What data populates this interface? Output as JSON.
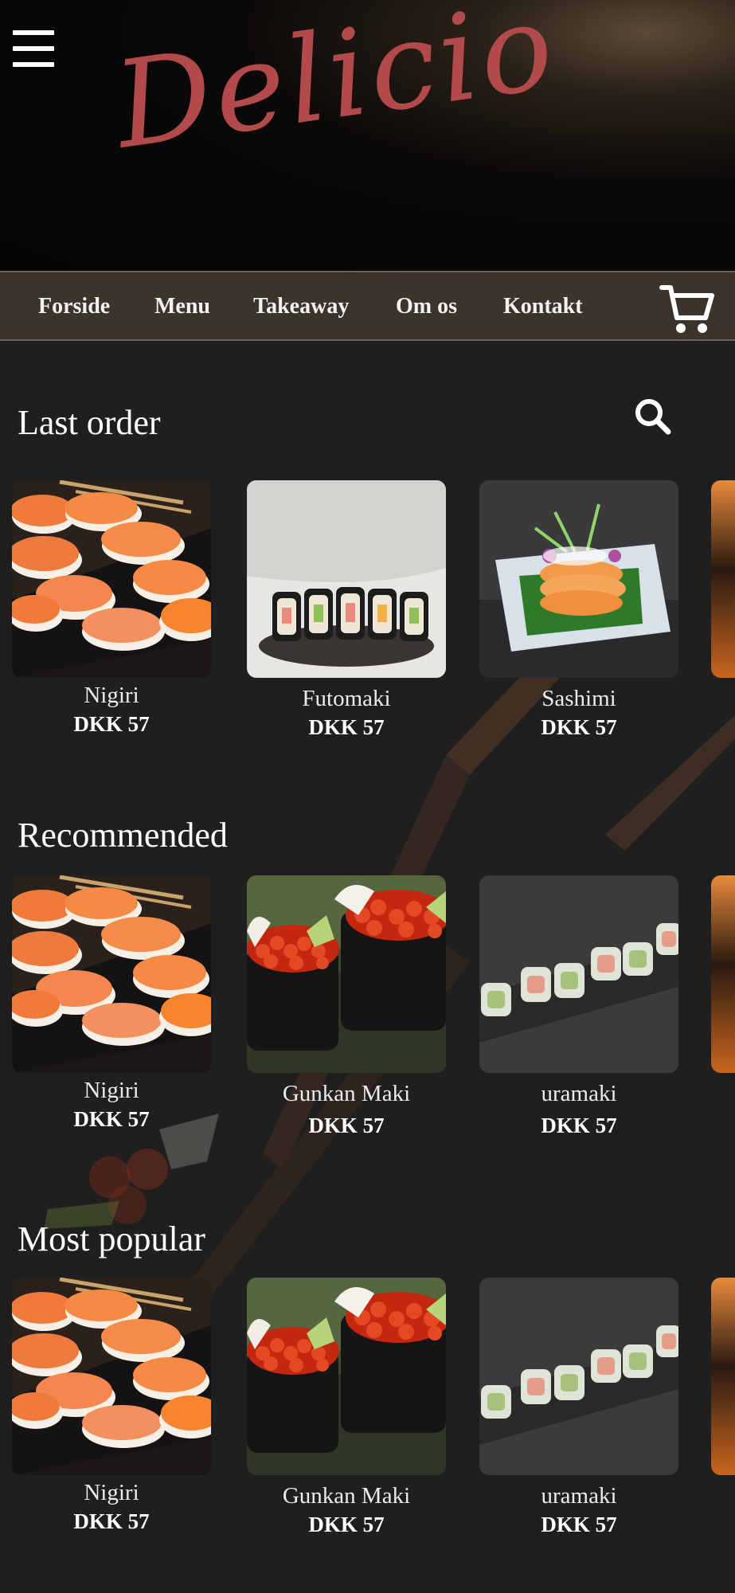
{
  "header": {
    "logo": "Delicio",
    "menu_icon": "hamburger-icon"
  },
  "nav": {
    "items": [
      "Forside",
      "Menu",
      "Takeaway",
      "Om os",
      "Kontakt"
    ],
    "cart_icon": "shopping-cart-icon"
  },
  "search_icon": "search-icon",
  "sections": [
    {
      "title": "Last order",
      "items": [
        {
          "name": "Nigiri",
          "price": "DKK 57",
          "image": "nigiri"
        },
        {
          "name": "Futomaki",
          "price": "DKK 57",
          "image": "futomaki"
        },
        {
          "name": "Sashimi",
          "price": "DKK 57",
          "image": "sashimi"
        }
      ]
    },
    {
      "title": "Recommended",
      "items": [
        {
          "name": "Nigiri",
          "price": "DKK 57",
          "image": "nigiri"
        },
        {
          "name": "Gunkan Maki",
          "price": "DKK 57",
          "image": "gunkan"
        },
        {
          "name": "uramaki",
          "price": "DKK 57",
          "image": "uramaki"
        }
      ]
    },
    {
      "title": "Most popular",
      "items": [
        {
          "name": "Nigiri",
          "price": "DKK 57",
          "image": "nigiri"
        },
        {
          "name": "Gunkan Maki",
          "price": "DKK 57",
          "image": "gunkan"
        },
        {
          "name": "uramaki",
          "price": "DKK 57",
          "image": "uramaki"
        }
      ]
    }
  ],
  "colors": {
    "background": "#1f1f1f",
    "nav_bar": "#3b342c",
    "logo": "#b24a4c",
    "text": "#ffffff"
  }
}
